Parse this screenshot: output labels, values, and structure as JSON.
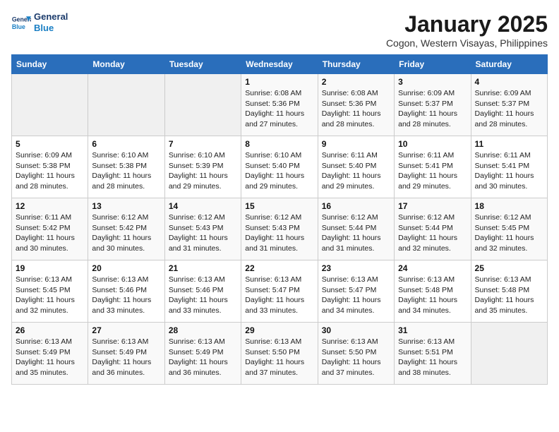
{
  "header": {
    "logo_line1": "General",
    "logo_line2": "Blue",
    "month": "January 2025",
    "location": "Cogon, Western Visayas, Philippines"
  },
  "weekdays": [
    "Sunday",
    "Monday",
    "Tuesday",
    "Wednesday",
    "Thursday",
    "Friday",
    "Saturday"
  ],
  "weeks": [
    [
      {
        "day": "",
        "sunrise": "",
        "sunset": "",
        "daylight": ""
      },
      {
        "day": "",
        "sunrise": "",
        "sunset": "",
        "daylight": ""
      },
      {
        "day": "",
        "sunrise": "",
        "sunset": "",
        "daylight": ""
      },
      {
        "day": "1",
        "sunrise": "Sunrise: 6:08 AM",
        "sunset": "Sunset: 5:36 PM",
        "daylight": "Daylight: 11 hours and 27 minutes."
      },
      {
        "day": "2",
        "sunrise": "Sunrise: 6:08 AM",
        "sunset": "Sunset: 5:36 PM",
        "daylight": "Daylight: 11 hours and 28 minutes."
      },
      {
        "day": "3",
        "sunrise": "Sunrise: 6:09 AM",
        "sunset": "Sunset: 5:37 PM",
        "daylight": "Daylight: 11 hours and 28 minutes."
      },
      {
        "day": "4",
        "sunrise": "Sunrise: 6:09 AM",
        "sunset": "Sunset: 5:37 PM",
        "daylight": "Daylight: 11 hours and 28 minutes."
      }
    ],
    [
      {
        "day": "5",
        "sunrise": "Sunrise: 6:09 AM",
        "sunset": "Sunset: 5:38 PM",
        "daylight": "Daylight: 11 hours and 28 minutes."
      },
      {
        "day": "6",
        "sunrise": "Sunrise: 6:10 AM",
        "sunset": "Sunset: 5:38 PM",
        "daylight": "Daylight: 11 hours and 28 minutes."
      },
      {
        "day": "7",
        "sunrise": "Sunrise: 6:10 AM",
        "sunset": "Sunset: 5:39 PM",
        "daylight": "Daylight: 11 hours and 29 minutes."
      },
      {
        "day": "8",
        "sunrise": "Sunrise: 6:10 AM",
        "sunset": "Sunset: 5:40 PM",
        "daylight": "Daylight: 11 hours and 29 minutes."
      },
      {
        "day": "9",
        "sunrise": "Sunrise: 6:11 AM",
        "sunset": "Sunset: 5:40 PM",
        "daylight": "Daylight: 11 hours and 29 minutes."
      },
      {
        "day": "10",
        "sunrise": "Sunrise: 6:11 AM",
        "sunset": "Sunset: 5:41 PM",
        "daylight": "Daylight: 11 hours and 29 minutes."
      },
      {
        "day": "11",
        "sunrise": "Sunrise: 6:11 AM",
        "sunset": "Sunset: 5:41 PM",
        "daylight": "Daylight: 11 hours and 30 minutes."
      }
    ],
    [
      {
        "day": "12",
        "sunrise": "Sunrise: 6:11 AM",
        "sunset": "Sunset: 5:42 PM",
        "daylight": "Daylight: 11 hours and 30 minutes."
      },
      {
        "day": "13",
        "sunrise": "Sunrise: 6:12 AM",
        "sunset": "Sunset: 5:42 PM",
        "daylight": "Daylight: 11 hours and 30 minutes."
      },
      {
        "day": "14",
        "sunrise": "Sunrise: 6:12 AM",
        "sunset": "Sunset: 5:43 PM",
        "daylight": "Daylight: 11 hours and 31 minutes."
      },
      {
        "day": "15",
        "sunrise": "Sunrise: 6:12 AM",
        "sunset": "Sunset: 5:43 PM",
        "daylight": "Daylight: 11 hours and 31 minutes."
      },
      {
        "day": "16",
        "sunrise": "Sunrise: 6:12 AM",
        "sunset": "Sunset: 5:44 PM",
        "daylight": "Daylight: 11 hours and 31 minutes."
      },
      {
        "day": "17",
        "sunrise": "Sunrise: 6:12 AM",
        "sunset": "Sunset: 5:44 PM",
        "daylight": "Daylight: 11 hours and 32 minutes."
      },
      {
        "day": "18",
        "sunrise": "Sunrise: 6:12 AM",
        "sunset": "Sunset: 5:45 PM",
        "daylight": "Daylight: 11 hours and 32 minutes."
      }
    ],
    [
      {
        "day": "19",
        "sunrise": "Sunrise: 6:13 AM",
        "sunset": "Sunset: 5:45 PM",
        "daylight": "Daylight: 11 hours and 32 minutes."
      },
      {
        "day": "20",
        "sunrise": "Sunrise: 6:13 AM",
        "sunset": "Sunset: 5:46 PM",
        "daylight": "Daylight: 11 hours and 33 minutes."
      },
      {
        "day": "21",
        "sunrise": "Sunrise: 6:13 AM",
        "sunset": "Sunset: 5:46 PM",
        "daylight": "Daylight: 11 hours and 33 minutes."
      },
      {
        "day": "22",
        "sunrise": "Sunrise: 6:13 AM",
        "sunset": "Sunset: 5:47 PM",
        "daylight": "Daylight: 11 hours and 33 minutes."
      },
      {
        "day": "23",
        "sunrise": "Sunrise: 6:13 AM",
        "sunset": "Sunset: 5:47 PM",
        "daylight": "Daylight: 11 hours and 34 minutes."
      },
      {
        "day": "24",
        "sunrise": "Sunrise: 6:13 AM",
        "sunset": "Sunset: 5:48 PM",
        "daylight": "Daylight: 11 hours and 34 minutes."
      },
      {
        "day": "25",
        "sunrise": "Sunrise: 6:13 AM",
        "sunset": "Sunset: 5:48 PM",
        "daylight": "Daylight: 11 hours and 35 minutes."
      }
    ],
    [
      {
        "day": "26",
        "sunrise": "Sunrise: 6:13 AM",
        "sunset": "Sunset: 5:49 PM",
        "daylight": "Daylight: 11 hours and 35 minutes."
      },
      {
        "day": "27",
        "sunrise": "Sunrise: 6:13 AM",
        "sunset": "Sunset: 5:49 PM",
        "daylight": "Daylight: 11 hours and 36 minutes."
      },
      {
        "day": "28",
        "sunrise": "Sunrise: 6:13 AM",
        "sunset": "Sunset: 5:49 PM",
        "daylight": "Daylight: 11 hours and 36 minutes."
      },
      {
        "day": "29",
        "sunrise": "Sunrise: 6:13 AM",
        "sunset": "Sunset: 5:50 PM",
        "daylight": "Daylight: 11 hours and 37 minutes."
      },
      {
        "day": "30",
        "sunrise": "Sunrise: 6:13 AM",
        "sunset": "Sunset: 5:50 PM",
        "daylight": "Daylight: 11 hours and 37 minutes."
      },
      {
        "day": "31",
        "sunrise": "Sunrise: 6:13 AM",
        "sunset": "Sunset: 5:51 PM",
        "daylight": "Daylight: 11 hours and 38 minutes."
      },
      {
        "day": "",
        "sunrise": "",
        "sunset": "",
        "daylight": ""
      }
    ]
  ]
}
